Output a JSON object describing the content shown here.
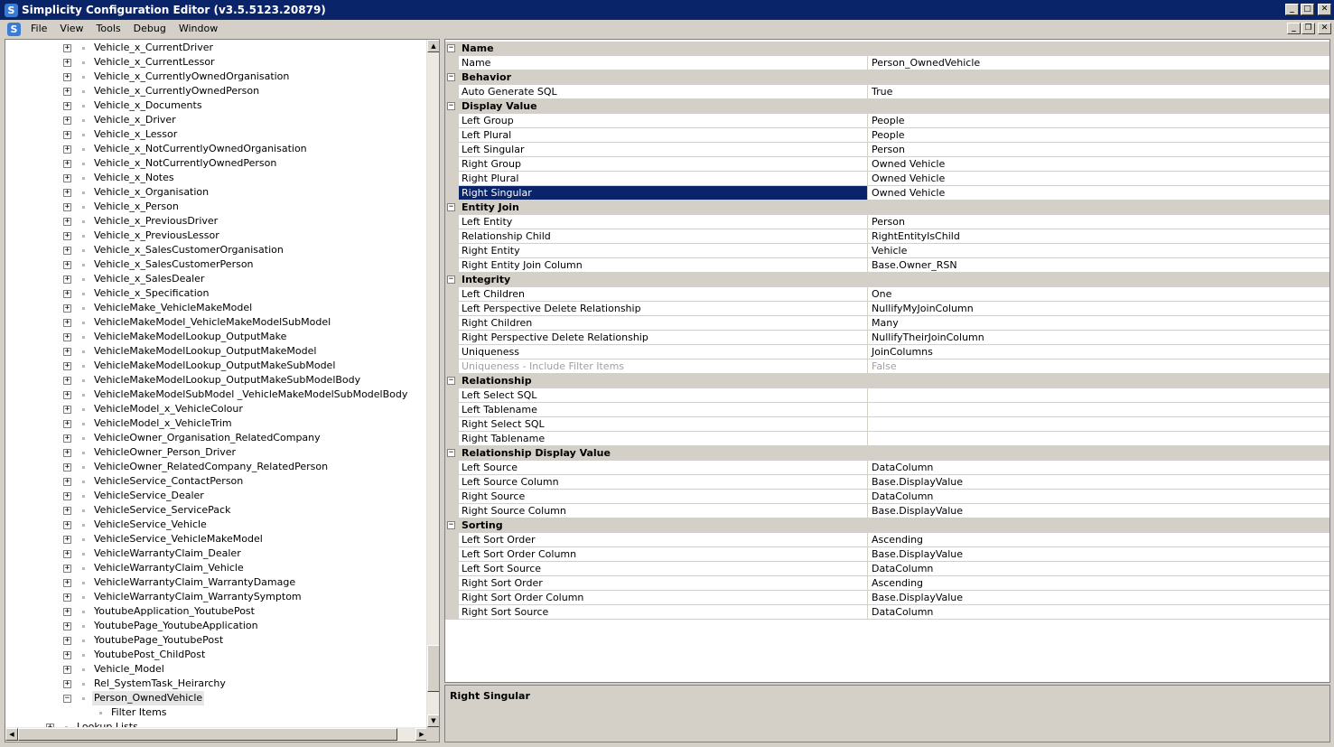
{
  "window": {
    "title": "Simplicity Configuration Editor (v3.5.5123.20879)",
    "app_icon_letter": "S",
    "minimize_glyph": "_",
    "maximize_glyph": "□",
    "close_glyph": "✕",
    "restore_glyph": "❐"
  },
  "menu": {
    "items": [
      "File",
      "View",
      "Tools",
      "Debug",
      "Window"
    ]
  },
  "tree": {
    "items": [
      {
        "label": "Vehicle_x_CurrentDriver",
        "expander": "+",
        "level": 2
      },
      {
        "label": "Vehicle_x_CurrentLessor",
        "expander": "+",
        "level": 2
      },
      {
        "label": "Vehicle_x_CurrentlyOwnedOrganisation",
        "expander": "+",
        "level": 2
      },
      {
        "label": "Vehicle_x_CurrentlyOwnedPerson",
        "expander": "+",
        "level": 2
      },
      {
        "label": "Vehicle_x_Documents",
        "expander": "+",
        "level": 2
      },
      {
        "label": "Vehicle_x_Driver",
        "expander": "+",
        "level": 2
      },
      {
        "label": "Vehicle_x_Lessor",
        "expander": "+",
        "level": 2
      },
      {
        "label": "Vehicle_x_NotCurrentlyOwnedOrganisation",
        "expander": "+",
        "level": 2
      },
      {
        "label": "Vehicle_x_NotCurrentlyOwnedPerson",
        "expander": "+",
        "level": 2
      },
      {
        "label": "Vehicle_x_Notes",
        "expander": "+",
        "level": 2
      },
      {
        "label": "Vehicle_x_Organisation",
        "expander": "+",
        "level": 2
      },
      {
        "label": "Vehicle_x_Person",
        "expander": "+",
        "level": 2
      },
      {
        "label": "Vehicle_x_PreviousDriver",
        "expander": "+",
        "level": 2
      },
      {
        "label": "Vehicle_x_PreviousLessor",
        "expander": "+",
        "level": 2
      },
      {
        "label": "Vehicle_x_SalesCustomerOrganisation",
        "expander": "+",
        "level": 2
      },
      {
        "label": "Vehicle_x_SalesCustomerPerson",
        "expander": "+",
        "level": 2
      },
      {
        "label": "Vehicle_x_SalesDealer",
        "expander": "+",
        "level": 2
      },
      {
        "label": "Vehicle_x_Specification",
        "expander": "+",
        "level": 2
      },
      {
        "label": "VehicleMake_VehicleMakeModel",
        "expander": "+",
        "level": 2
      },
      {
        "label": "VehicleMakeModel_VehicleMakeModelSubModel",
        "expander": "+",
        "level": 2
      },
      {
        "label": "VehicleMakeModelLookup_OutputMake",
        "expander": "+",
        "level": 2
      },
      {
        "label": "VehicleMakeModelLookup_OutputMakeModel",
        "expander": "+",
        "level": 2
      },
      {
        "label": "VehicleMakeModelLookup_OutputMakeSubModel",
        "expander": "+",
        "level": 2
      },
      {
        "label": "VehicleMakeModelLookup_OutputMakeSubModelBody",
        "expander": "+",
        "level": 2
      },
      {
        "label": "VehicleMakeModelSubModel _VehicleMakeModelSubModelBody",
        "expander": "+",
        "level": 2
      },
      {
        "label": "VehicleModel_x_VehicleColour",
        "expander": "+",
        "level": 2
      },
      {
        "label": "VehicleModel_x_VehicleTrim",
        "expander": "+",
        "level": 2
      },
      {
        "label": "VehicleOwner_Organisation_RelatedCompany",
        "expander": "+",
        "level": 2
      },
      {
        "label": "VehicleOwner_Person_Driver",
        "expander": "+",
        "level": 2
      },
      {
        "label": "VehicleOwner_RelatedCompany_RelatedPerson",
        "expander": "+",
        "level": 2
      },
      {
        "label": "VehicleService_ContactPerson",
        "expander": "+",
        "level": 2
      },
      {
        "label": "VehicleService_Dealer",
        "expander": "+",
        "level": 2
      },
      {
        "label": "VehicleService_ServicePack",
        "expander": "+",
        "level": 2
      },
      {
        "label": "VehicleService_Vehicle",
        "expander": "+",
        "level": 2
      },
      {
        "label": "VehicleService_VehicleMakeModel",
        "expander": "+",
        "level": 2
      },
      {
        "label": "VehicleWarrantyClaim_Dealer",
        "expander": "+",
        "level": 2
      },
      {
        "label": "VehicleWarrantyClaim_Vehicle",
        "expander": "+",
        "level": 2
      },
      {
        "label": "VehicleWarrantyClaim_WarrantyDamage",
        "expander": "+",
        "level": 2
      },
      {
        "label": "VehicleWarrantyClaim_WarrantySymptom",
        "expander": "+",
        "level": 2
      },
      {
        "label": "YoutubeApplication_YoutubePost",
        "expander": "+",
        "level": 2
      },
      {
        "label": "YoutubePage_YoutubeApplication",
        "expander": "+",
        "level": 2
      },
      {
        "label": "YoutubePage_YoutubePost",
        "expander": "+",
        "level": 2
      },
      {
        "label": "YoutubePost_ChildPost",
        "expander": "+",
        "level": 2
      },
      {
        "label": "Vehicle_Model",
        "expander": "+",
        "level": 2
      },
      {
        "label": "Rel_SystemTask_Heirarchy",
        "expander": "+",
        "level": 2
      },
      {
        "label": "Person_OwnedVehicle",
        "expander": "−",
        "level": 2,
        "selected": true
      },
      {
        "label": "Filter Items",
        "expander": "",
        "level": 3
      },
      {
        "label": "Lookup Lists",
        "expander": "+",
        "level": 1
      }
    ]
  },
  "properties": {
    "categories": [
      {
        "name": "Name",
        "rows": [
          {
            "name": "Name",
            "value": "Person_OwnedVehicle"
          }
        ]
      },
      {
        "name": "Behavior",
        "rows": [
          {
            "name": "Auto Generate SQL",
            "value": "True"
          }
        ]
      },
      {
        "name": "Display Value",
        "rows": [
          {
            "name": "Left Group",
            "value": "People"
          },
          {
            "name": "Left Plural",
            "value": "People"
          },
          {
            "name": "Left Singular",
            "value": "Person"
          },
          {
            "name": "Right Group",
            "value": "Owned Vehicle"
          },
          {
            "name": "Right Plural",
            "value": "Owned Vehicle"
          },
          {
            "name": "Right Singular",
            "value": "Owned Vehicle",
            "selected": true
          }
        ]
      },
      {
        "name": "Entity Join",
        "rows": [
          {
            "name": "Left Entity",
            "value": "Person"
          },
          {
            "name": "Relationship Child",
            "value": "RightEntityIsChild"
          },
          {
            "name": "Right Entity",
            "value": "Vehicle"
          },
          {
            "name": "Right Entity Join Column",
            "value": "Base.Owner_RSN"
          }
        ]
      },
      {
        "name": "Integrity",
        "rows": [
          {
            "name": "Left Children",
            "value": "One"
          },
          {
            "name": "Left Perspective Delete Relationship",
            "value": "NullifyMyJoinColumn"
          },
          {
            "name": "Right Children",
            "value": "Many"
          },
          {
            "name": "Right Perspective Delete Relationship",
            "value": "NullifyTheirJoinColumn"
          },
          {
            "name": "Uniqueness",
            "value": "JoinColumns"
          },
          {
            "name": "Uniqueness - Include Filter Items",
            "value": "False",
            "disabled": true
          }
        ]
      },
      {
        "name": "Relationship",
        "rows": [
          {
            "name": "Left Select SQL",
            "value": ""
          },
          {
            "name": "Left Tablename",
            "value": ""
          },
          {
            "name": "Right Select SQL",
            "value": ""
          },
          {
            "name": "Right Tablename",
            "value": ""
          }
        ]
      },
      {
        "name": "Relationship Display Value",
        "rows": [
          {
            "name": "Left Source",
            "value": "DataColumn"
          },
          {
            "name": "Left Source Column",
            "value": "Base.DisplayValue"
          },
          {
            "name": "Right Source",
            "value": "DataColumn"
          },
          {
            "name": "Right Source Column",
            "value": "Base.DisplayValue"
          }
        ]
      },
      {
        "name": "Sorting",
        "rows": [
          {
            "name": "Left Sort Order",
            "value": "Ascending"
          },
          {
            "name": "Left Sort Order Column",
            "value": "Base.DisplayValue"
          },
          {
            "name": "Left Sort Source",
            "value": "DataColumn"
          },
          {
            "name": "Right Sort Order",
            "value": "Ascending"
          },
          {
            "name": "Right Sort Order Column",
            "value": "Base.DisplayValue"
          },
          {
            "name": "Right Sort Source",
            "value": "DataColumn"
          }
        ]
      }
    ],
    "collapse_glyph": "−"
  },
  "description": {
    "title": "Right Singular"
  },
  "colors": {
    "titlebar": "#0a246a",
    "selection": "#0a246a",
    "face": "#d4d0c8"
  }
}
